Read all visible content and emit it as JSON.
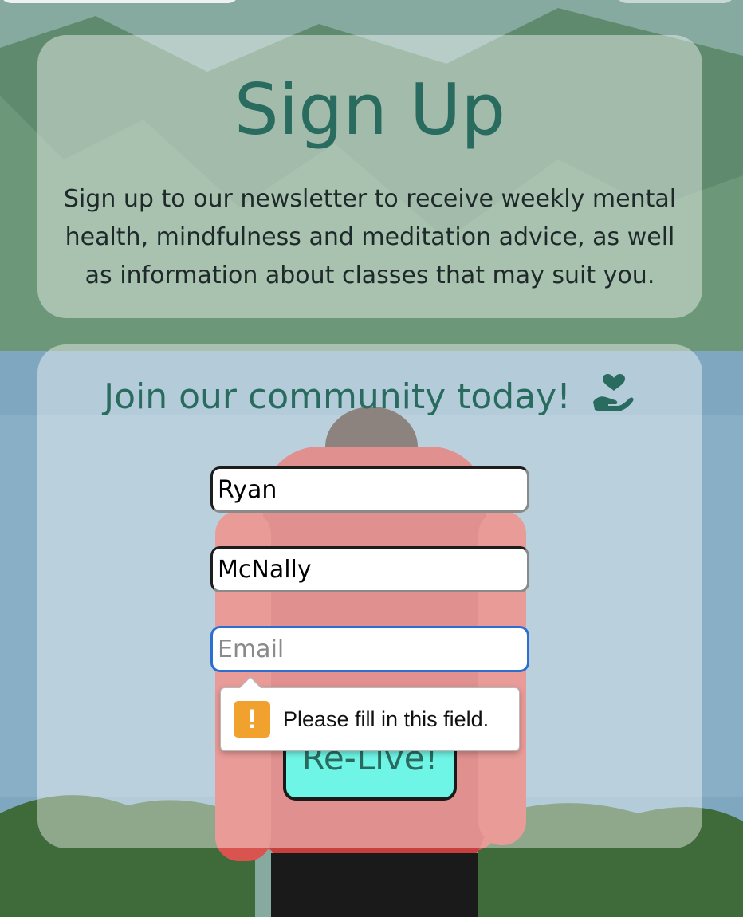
{
  "header": {
    "title": "Sign Up",
    "intro": "Sign up to our newsletter to receive weekly mental health, mindfulness and meditation advice, as well as information about classes that may suit you."
  },
  "form": {
    "heading": "Join our community today!",
    "heading_icon": "hand-holding-heart-icon",
    "first_name": {
      "value": "Ryan"
    },
    "last_name": {
      "value": "McNally"
    },
    "email": {
      "value": "",
      "placeholder": "Email"
    },
    "submit_label": "Re-Live!"
  },
  "validation": {
    "message": "Please fill in this field.",
    "icon": "warning-icon"
  },
  "colors": {
    "accent": "#2a6b5f",
    "button": "#6ff5e6",
    "focus": "#2d6fd0",
    "warning": "#f0a12e"
  }
}
